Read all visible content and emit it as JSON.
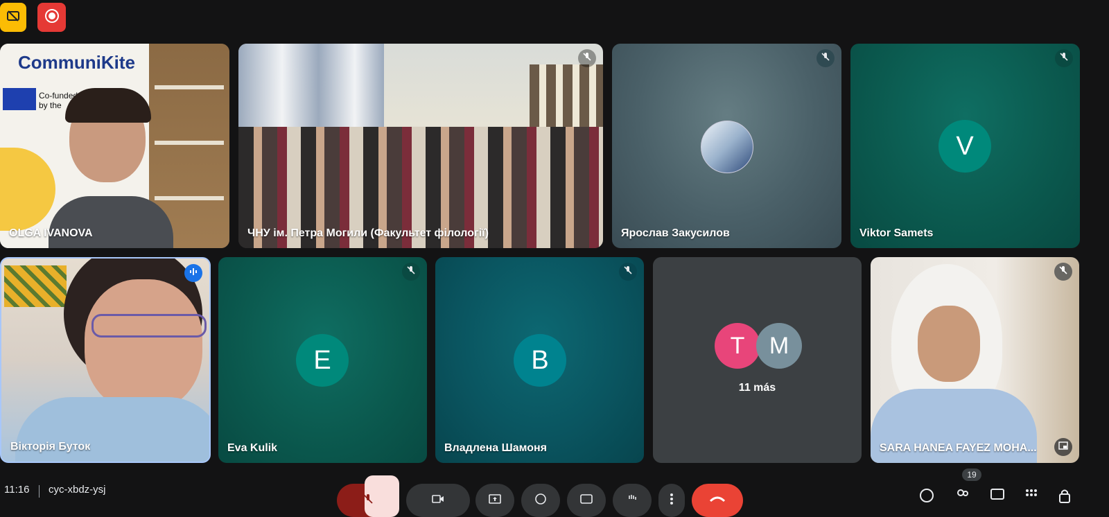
{
  "top": {
    "rec_icon": "record-icon",
    "captions_off_icon": "captions-off-icon"
  },
  "tiles": [
    {
      "name": "OLGA IVANOVA",
      "muted": false
    },
    {
      "name": "ЧНУ ім. Петра Могили (Факультет філології)",
      "muted": true
    },
    {
      "name": "Ярослав Закусилов",
      "muted": true
    },
    {
      "name": "Viktor Samets",
      "muted": true,
      "initial": "V"
    },
    {
      "name": "Вікторія Буток",
      "speaking": true
    },
    {
      "name": "Eva Kulik",
      "muted": true,
      "initial": "E"
    },
    {
      "name": "Владлена Шамоня",
      "muted": true,
      "initial": "В"
    },
    {
      "more_label": "11 más",
      "initials": [
        "T",
        "M"
      ]
    },
    {
      "name": "SARA HANEA FAYEZ MOHA...",
      "muted": true
    }
  ],
  "poster": {
    "brand": "CommuniKite",
    "cofunded": "Co-funded by the European Union"
  },
  "bottom": {
    "time": "11:16",
    "meeting_code": "cyc-xbdz-ysj",
    "participants_badge": "19"
  },
  "colors": {
    "background": "#131314",
    "tile_gray": "#3c4043",
    "end_call": "#ea4335",
    "record": "#e53935",
    "captions": "#fbbc04",
    "avatar_teal": "#00897b",
    "avatar_cyan": "#00838f",
    "avatar_pink": "#e8457a",
    "avatar_slate": "#78909c"
  }
}
